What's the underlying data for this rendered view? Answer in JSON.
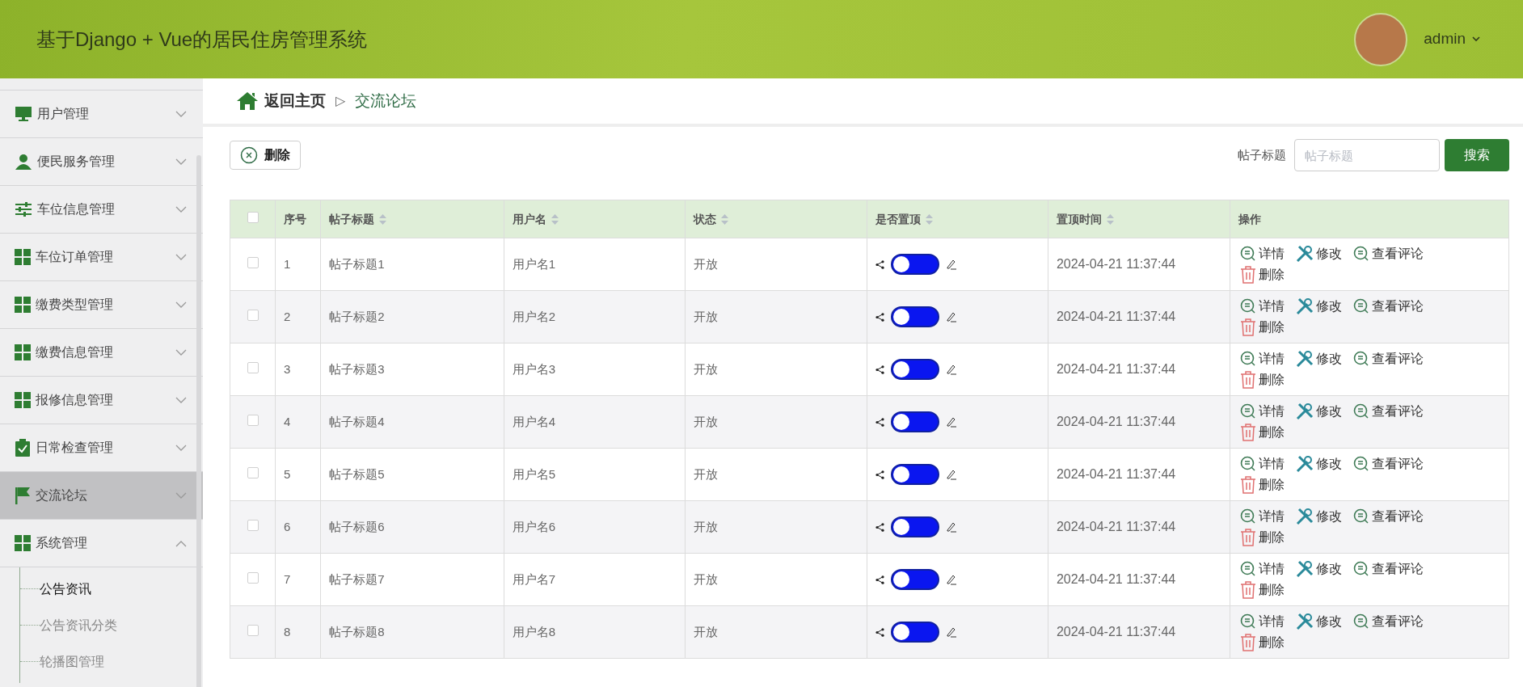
{
  "header": {
    "title": "基于Django + Vue的居民住房管理系统",
    "user": {
      "name": "admin"
    }
  },
  "sidebar": {
    "items": [
      {
        "label": "用户管理",
        "expanded": false,
        "selected": false
      },
      {
        "label": "便民服务管理",
        "expanded": false,
        "selected": false
      },
      {
        "label": "车位信息管理",
        "expanded": false,
        "selected": false
      },
      {
        "label": "车位订单管理",
        "expanded": false,
        "selected": false
      },
      {
        "label": "缴费类型管理",
        "expanded": false,
        "selected": false
      },
      {
        "label": "缴费信息管理",
        "expanded": false,
        "selected": false
      },
      {
        "label": "报修信息管理",
        "expanded": false,
        "selected": false
      },
      {
        "label": "日常检查管理",
        "expanded": false,
        "selected": false
      },
      {
        "label": "交流论坛",
        "expanded": false,
        "selected": true
      },
      {
        "label": "系统管理",
        "expanded": true,
        "selected": false,
        "children": [
          {
            "label": "公告资讯",
            "selected": true
          },
          {
            "label": "公告资讯分类",
            "selected": false
          },
          {
            "label": "轮播图管理",
            "selected": false
          }
        ]
      }
    ]
  },
  "breadcrumb": {
    "home": "返回主页",
    "separator": "▷",
    "current": "交流论坛"
  },
  "toolbar": {
    "delete_button": "删除",
    "search_label": "帖子标题",
    "search_placeholder": "帖子标题",
    "search_button": "搜索"
  },
  "table": {
    "select_all": {
      "checked": false
    },
    "columns": [
      {
        "label": "序号",
        "sortable": false
      },
      {
        "label": "帖子标题",
        "sortable": true
      },
      {
        "label": "用户名",
        "sortable": true
      },
      {
        "label": "状态",
        "sortable": true
      },
      {
        "label": "是否置顶",
        "sortable": true
      },
      {
        "label": "置顶时间",
        "sortable": true
      },
      {
        "label": "操作",
        "sortable": false
      }
    ],
    "rows": [
      {
        "checked": false,
        "index": "1",
        "title": "帖子标题1",
        "user": "用户名1",
        "status": "开放",
        "pinned": false,
        "time": "2024-04-21 11:37:44",
        "actions": [
          {
            "kind": "detail",
            "label": "详情"
          },
          {
            "kind": "edit",
            "label": "修改"
          },
          {
            "kind": "comments",
            "label": "查看评论"
          },
          {
            "kind": "delete",
            "label": "删除"
          }
        ]
      },
      {
        "checked": false,
        "index": "2",
        "title": "帖子标题2",
        "user": "用户名2",
        "status": "开放",
        "pinned": false,
        "time": "2024-04-21 11:37:44",
        "actions": [
          {
            "kind": "detail",
            "label": "详情"
          },
          {
            "kind": "edit",
            "label": "修改"
          },
          {
            "kind": "comments",
            "label": "查看评论"
          },
          {
            "kind": "delete",
            "label": "删除"
          }
        ]
      },
      {
        "checked": false,
        "index": "3",
        "title": "帖子标题3",
        "user": "用户名3",
        "status": "开放",
        "pinned": false,
        "time": "2024-04-21 11:37:44",
        "actions": [
          {
            "kind": "detail",
            "label": "详情"
          },
          {
            "kind": "edit",
            "label": "修改"
          },
          {
            "kind": "comments",
            "label": "查看评论"
          },
          {
            "kind": "delete",
            "label": "删除"
          }
        ]
      },
      {
        "checked": false,
        "index": "4",
        "title": "帖子标题4",
        "user": "用户名4",
        "status": "开放",
        "pinned": false,
        "time": "2024-04-21 11:37:44",
        "actions": [
          {
            "kind": "detail",
            "label": "详情"
          },
          {
            "kind": "edit",
            "label": "修改"
          },
          {
            "kind": "comments",
            "label": "查看评论"
          },
          {
            "kind": "delete",
            "label": "删除"
          }
        ]
      },
      {
        "checked": false,
        "index": "5",
        "title": "帖子标题5",
        "user": "用户名5",
        "status": "开放",
        "pinned": false,
        "time": "2024-04-21 11:37:44",
        "actions": [
          {
            "kind": "detail",
            "label": "详情"
          },
          {
            "kind": "edit",
            "label": "修改"
          },
          {
            "kind": "comments",
            "label": "查看评论"
          },
          {
            "kind": "delete",
            "label": "删除"
          }
        ]
      },
      {
        "checked": false,
        "index": "6",
        "title": "帖子标题6",
        "user": "用户名6",
        "status": "开放",
        "pinned": false,
        "time": "2024-04-21 11:37:44",
        "actions": [
          {
            "kind": "detail",
            "label": "详情"
          },
          {
            "kind": "edit",
            "label": "修改"
          },
          {
            "kind": "comments",
            "label": "查看评论"
          },
          {
            "kind": "delete",
            "label": "删除"
          }
        ]
      },
      {
        "checked": false,
        "index": "7",
        "title": "帖子标题7",
        "user": "用户名7",
        "status": "开放",
        "pinned": false,
        "time": "2024-04-21 11:37:44",
        "actions": [
          {
            "kind": "detail",
            "label": "详情"
          },
          {
            "kind": "edit",
            "label": "修改"
          },
          {
            "kind": "comments",
            "label": "查看评论"
          },
          {
            "kind": "delete",
            "label": "删除"
          }
        ]
      },
      {
        "checked": false,
        "index": "8",
        "title": "帖子标题8",
        "user": "用户名8",
        "status": "开放",
        "pinned": false,
        "time": "2024-04-21 11:37:44",
        "actions": [
          {
            "kind": "detail",
            "label": "详情"
          },
          {
            "kind": "edit",
            "label": "修改"
          },
          {
            "kind": "comments",
            "label": "查看评论"
          },
          {
            "kind": "delete",
            "label": "删除"
          }
        ]
      }
    ]
  }
}
